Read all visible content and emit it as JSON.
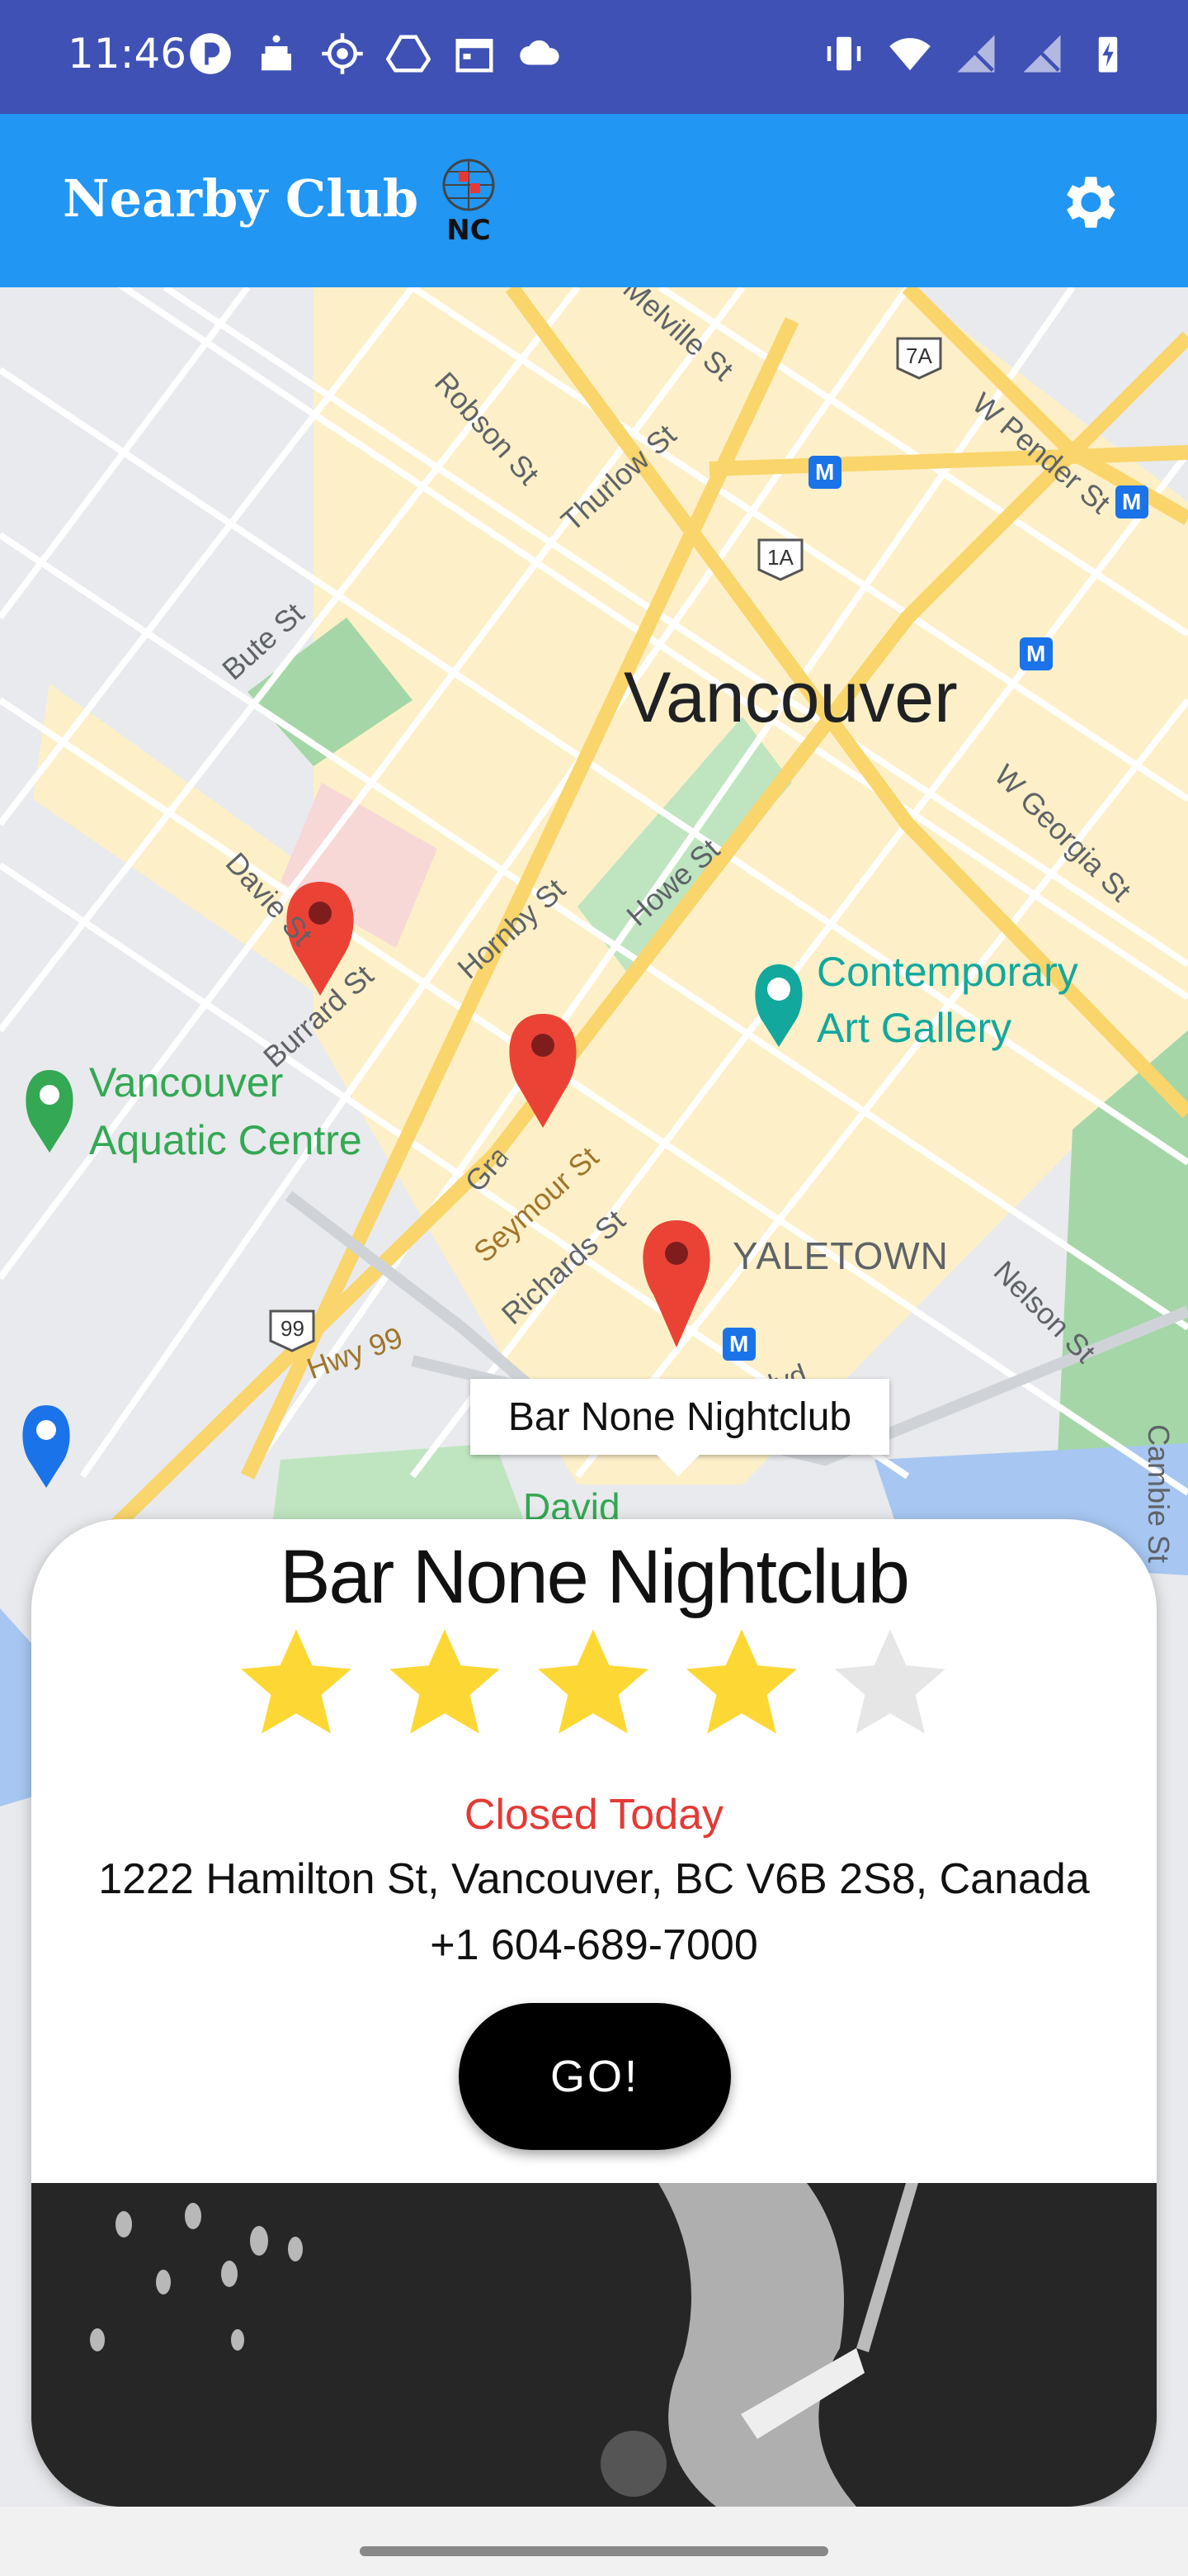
{
  "status_bar": {
    "time": "11:46",
    "left_icons": [
      "p-app-icon",
      "cake-icon",
      "location-icon",
      "drive-icon",
      "calendar-icon",
      "cloud-icon"
    ],
    "right_icons": [
      "vibrate-icon",
      "wifi-icon",
      "no-signal-icon",
      "no-signal-icon",
      "battery-charging-icon"
    ]
  },
  "app_bar": {
    "title": "Nearby Club",
    "logo_text": "NC",
    "settings_icon": "gear-icon"
  },
  "map": {
    "city_label": "Vancouver",
    "street_labels": [
      "Melville St",
      "Robson St",
      "Thurlow St",
      "W Pender St",
      "Bute St",
      "W Georgia St",
      "Davie St",
      "Hornby St",
      "Howe St",
      "Burrard St",
      "Granville St",
      "Seymour St",
      "Richards St",
      "Nelson St",
      "Hwy 99",
      "Pacific Blvd",
      "Cambie St"
    ],
    "area_labels": [
      "YALETOWN"
    ],
    "poi_labels": [
      "Contemporary",
      "Art Gallery",
      "Vancouver",
      "Aquatic Centre",
      "David"
    ],
    "route_shields": [
      "7A",
      "1A",
      "99"
    ],
    "transit_icon": "M",
    "selected_marker_label": "Bar None Nightclub"
  },
  "place_card": {
    "name": "Bar None Nightclub",
    "rating": 4,
    "rating_max": 5,
    "status": "Closed Today",
    "address": "1222 Hamilton St, Vancouver, BC V6B 2S8, Canada",
    "phone": "+1 604-689-7000",
    "go_label": "GO!"
  },
  "colors": {
    "status_bar": "#3f51b5",
    "app_bar": "#2196f3",
    "star_filled": "#fdd835",
    "star_empty": "#e6e6e6",
    "closed": "#e53935",
    "marker": "#ea4335"
  }
}
